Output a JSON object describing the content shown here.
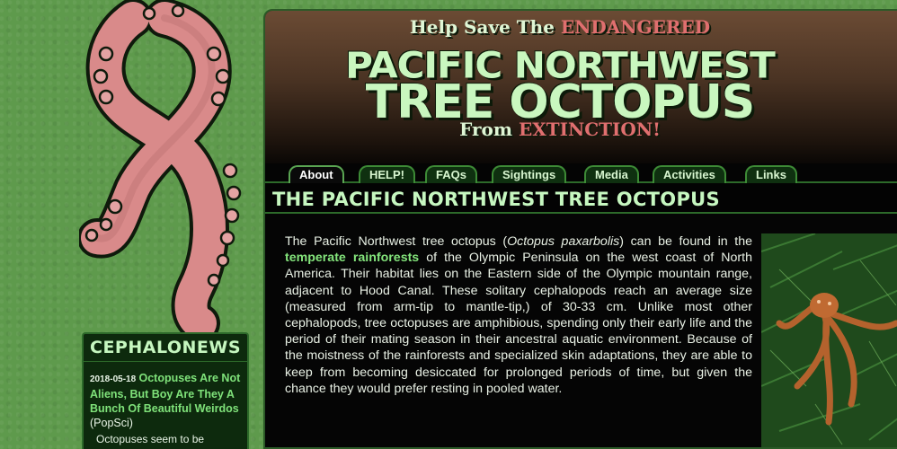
{
  "banner": {
    "line1_pre": "Help Save The ",
    "line1_red": "ENDANGERED",
    "title1": "PACIFIC NORTHWEST",
    "title2": "TREE OCTOPUS",
    "line3_pre": "From ",
    "line3_red": "EXTINCTION!"
  },
  "tabs": [
    {
      "label": "About",
      "active": true
    },
    {
      "label": "HELP!",
      "active": false
    },
    {
      "label": "FAQs",
      "active": false
    },
    {
      "label": "Sightings",
      "active": false
    },
    {
      "label": "Media",
      "active": false
    },
    {
      "label": "Activities",
      "active": false
    },
    {
      "label": "Links",
      "active": false
    }
  ],
  "page_heading": "THE PACIFIC NORTHWEST TREE OCTOPUS",
  "body": {
    "p1_a": "The Pacific Northwest tree octopus (",
    "p1_sci": "Octopus paxarbolis",
    "p1_b": ") can be found in the ",
    "p1_link": "temperate rainforests",
    "p1_c": " of the Olympic Peninsula on the west coast of North America. Their habitat lies on the Eastern side of the Olympic mountain range, adjacent to Hood Canal. These solitary cephalopods reach an average size (measured from arm-tip to mantle-tip,) of 30-33 cm. Unlike most other cephalopods, tree octopuses are amphibious, spending only their early life and the period of their mating season in their ancestral aquatic environment. Because of the moistness of the rainforests and specialized skin adaptations, they are able to keep from becoming desiccated for prolonged periods of time, but given the chance they would prefer resting in pooled water."
  },
  "news": {
    "title": "CEPHALONEWS",
    "date": "2018-05-18",
    "headline": "Octopuses Are Not Aliens, But Boy Are They A Bunch Of Beautiful Weirdos",
    "source": "(PopSci)",
    "excerpt": "Octopuses seem to be"
  },
  "colors": {
    "accent_green": "#84e57c",
    "title_green": "#c9f7bf",
    "red": "#e06f6f",
    "page_bg": "#5e9a4c"
  },
  "icons": {
    "logo": "octopus-tentacle-ribbon",
    "photo": "tree-octopus-photo"
  }
}
